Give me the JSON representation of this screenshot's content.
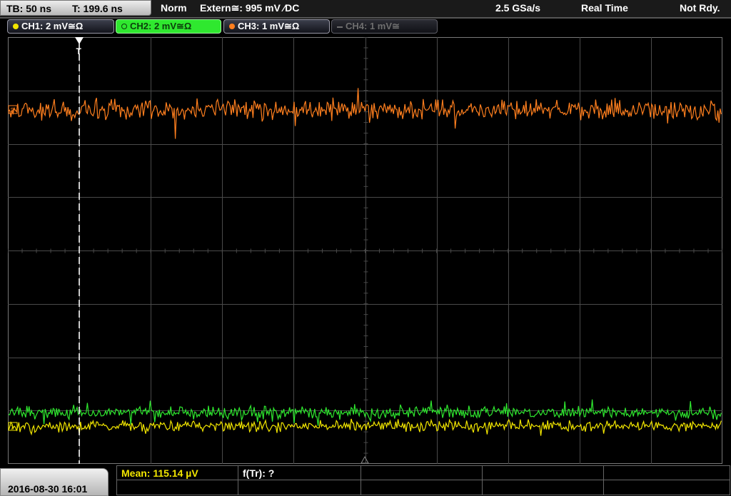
{
  "topbar": {
    "timebase": "TB: 50 ns",
    "trigger_time": "T: 199.6 ns",
    "trigger_mode": "Norm",
    "trigger_source": "Extern≅: 995 mV ∕DC",
    "sample_rate": "2.5 GSa/s",
    "acq_mode": "Real Time",
    "status": "Not Rdy."
  },
  "channels": [
    {
      "label": "CH1: 2 mV≅Ω",
      "color": "#f2e600",
      "state": "on"
    },
    {
      "label": "CH2: 2 mV≅Ω",
      "color": "#2fe82f",
      "state": "active"
    },
    {
      "label": "CH3: 1 mV≅Ω",
      "color": "#ff7f1e",
      "state": "on"
    },
    {
      "label": "CH4: 1 mV≅",
      "color": "#6e6e6e",
      "state": "off"
    }
  ],
  "screen": {
    "trigger_marker": "T",
    "ch3_marker": "3",
    "ch1_marker": "1"
  },
  "bottombar": {
    "datetime": "2016-08-30 16:01",
    "measurements": [
      {
        "label": "Mean: 115.14 µV",
        "color": "#f2e600"
      },
      {
        "label": "f(Tr): ?",
        "color": "#ffffff"
      }
    ]
  },
  "colors": {
    "ch1": "#f2e600",
    "ch2": "#2fe82f",
    "ch3": "#ff7f1e",
    "grid": "#4a4a4a",
    "background": "#000000"
  }
}
